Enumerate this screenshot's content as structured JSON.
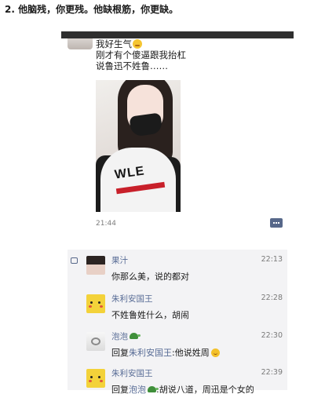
{
  "heading": "2. 他脑残，你更残。他缺根筋，你更缺。",
  "post": {
    "lines": [
      "我好生气",
      "刚才有个傻逼跟我抬杠",
      "说鲁迅不姓鲁……"
    ],
    "emoji_icon": "angry-face-emoji",
    "photo_print": "WLE",
    "time": "21:44"
  },
  "comments": [
    {
      "name": "果汁",
      "time": "22:13",
      "text": "你那么美，说的都对",
      "avatar": "girl-avatar"
    },
    {
      "name": "朱利安国王",
      "time": "22:28",
      "text": "不姓鲁姓什么，胡闹",
      "avatar": "pikachu-avatar"
    },
    {
      "name": "泡泡",
      "time": "22:30",
      "reply_prefix": "回复",
      "reply_to": "朱利安国王",
      "text": ":他说姓周",
      "avatar": "white-avatar"
    },
    {
      "name": "朱利安国王",
      "time": "22:39",
      "reply_prefix": "回复",
      "reply_to": "泡泡",
      "text": ":胡说八道，周迅是个女的",
      "avatar": "pikachu-avatar"
    }
  ],
  "colors": {
    "link": "#576b95",
    "comment_bg": "#f3f3f5",
    "top_bar": "#2f2f2f"
  }
}
